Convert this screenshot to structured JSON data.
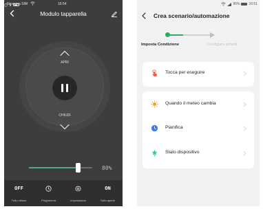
{
  "left_screen": {
    "status_bar": {
      "carrier": "Nessuna SIM",
      "time": "16:54"
    },
    "header": {
      "title": "Modulo tapparella"
    },
    "controls": {
      "open_label": "APRI",
      "close_label": "CHIUDI",
      "center_icon": "pause-icon"
    },
    "position": {
      "value": 0.8,
      "display": "80%"
    },
    "bottom_bar": [
      {
        "top": "OFF",
        "label": "Tutto chiuso"
      },
      {
        "icon": "clock-icon",
        "label": "Programma"
      },
      {
        "icon": "gear-icon",
        "label": "Impostazioni"
      },
      {
        "top": "ON",
        "label": "Tutto aperto"
      }
    ],
    "colors": {
      "background": "#3d3d3d",
      "accent": "#4caf7d"
    }
  },
  "right_screen": {
    "status_bar": {
      "signal": "95%",
      "time": "16:51"
    },
    "header": {
      "title": "Crea scenario/automazione"
    },
    "steps": [
      {
        "label": "Imposta Condizione",
        "active": true
      },
      {
        "label": "Configura attività",
        "active": false
      }
    ],
    "options": [
      {
        "label": "Tocca per eseguire",
        "icon": "tap-hand-icon",
        "color": "#f25c3b"
      },
      {
        "label": "Quando il meteo cambia",
        "icon": "sun-icon",
        "color": "#f5a623"
      },
      {
        "label": "Pianifica",
        "icon": "clock-icon",
        "color": "#3d7be0"
      },
      {
        "label": "Stato dispositivo",
        "icon": "device-icon",
        "color": "#2ecc9a"
      }
    ],
    "colors": {
      "background": "#f2f2f4",
      "accent": "#27ae60"
    }
  }
}
